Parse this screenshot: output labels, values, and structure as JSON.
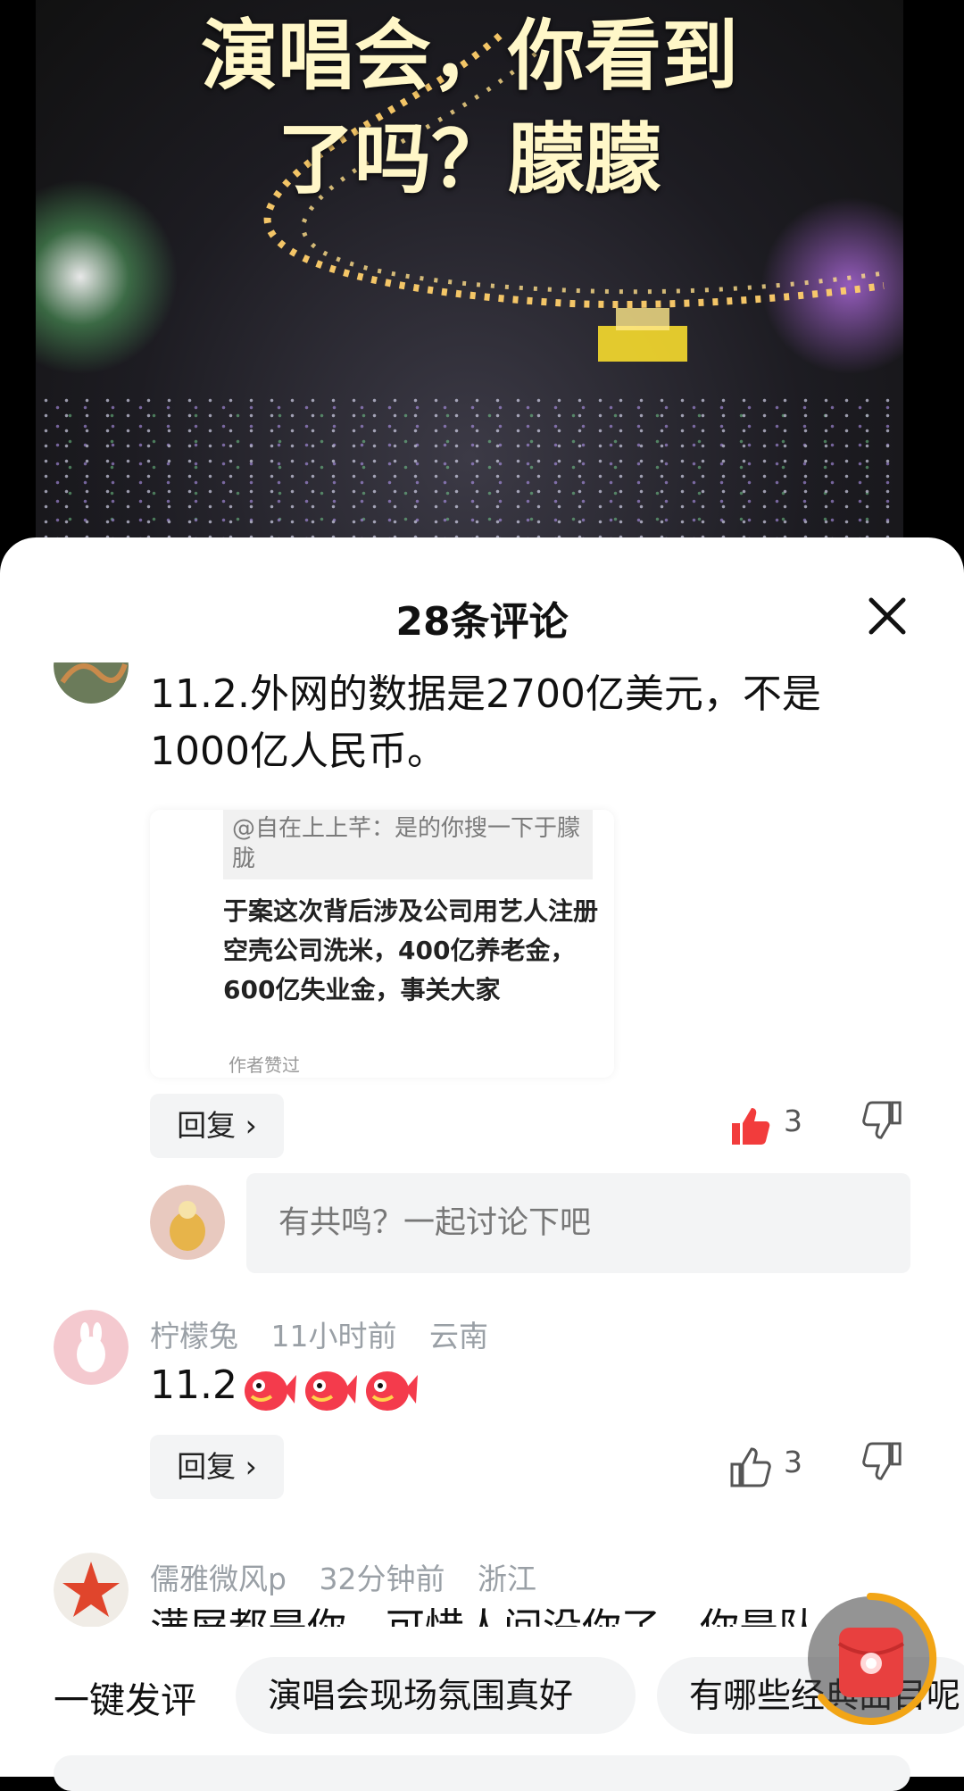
{
  "video": {
    "caption_line1": "演唱会，你看到",
    "caption_line2": "了吗？朦朦"
  },
  "sheet": {
    "title": "28条评论",
    "close_icon": "close-icon"
  },
  "comments": [
    {
      "username": "",
      "time": "",
      "location": "",
      "text_line1": "11.2.外网的数据是2700亿美元，不是",
      "text_line2": "1000亿人民币。",
      "quote": {
        "header": "@自在上上芊：是的你搜一下于朦胧",
        "body": "于案这次背后涉及公司用艺人注册空壳公司洗米，400亿养老金，600亿失业金，事关大家",
        "footer": "作者赞过"
      },
      "reply_label": "回复 ›",
      "likes": "3",
      "liked": true
    },
    {
      "username": "柠檬兔",
      "time": "11小时前",
      "location": "云南",
      "text": "11.2",
      "emoji": [
        "fish-emoji",
        "fish-emoji",
        "fish-emoji"
      ],
      "reply_label": "回复 ›",
      "likes": "3",
      "liked": false
    },
    {
      "username": "儒雅微风p",
      "time": "32分钟前",
      "location": "浙江",
      "text": "满屏都是你，可惜人间没你了，你是队"
    }
  ],
  "reply_input": {
    "placeholder": "有共鸣？一起讨论下吧"
  },
  "bottom": {
    "quick_label": "一键发评",
    "chips": [
      "演唱会现场氛围真好",
      "有哪些经典曲目呢"
    ]
  },
  "colors": {
    "like_active": "#f23c3c",
    "icon_gray": "#555555",
    "chip_bg": "#f3f4f5",
    "redpacket": "#e8403f",
    "ring": "#f2a516"
  }
}
